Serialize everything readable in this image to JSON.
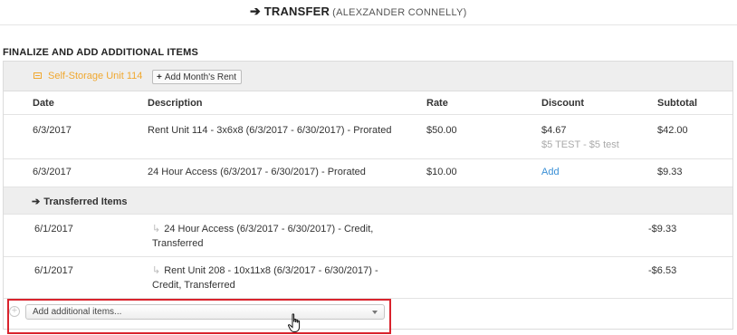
{
  "header": {
    "arrow": "➔",
    "title": "TRANSFER",
    "subtitle": "(ALEXZANDER CONNELLY)"
  },
  "section_title": "FINALIZE AND ADD ADDITIONAL ITEMS",
  "unit": {
    "icon": "storage-unit-icon",
    "name": "Self-Storage Unit 114",
    "add_rent_label": "Add Month's Rent",
    "plus": "+"
  },
  "table": {
    "columns": [
      "Date",
      "Description",
      "Rate",
      "Discount",
      "Subtotal"
    ],
    "rows": [
      {
        "date": "6/3/2017",
        "description": "Rent Unit 114 - 3x6x8 (6/3/2017 - 6/30/2017) - Prorated",
        "rate": "$50.00",
        "discount": "$4.67",
        "discount_note": "$5 TEST - $5 test",
        "subtotal": "$42.00"
      },
      {
        "date": "6/3/2017",
        "description": "24 Hour Access (6/3/2017 - 6/30/2017) - Prorated",
        "rate": "$10.00",
        "discount_link": "Add",
        "subtotal": "$9.33"
      }
    ]
  },
  "transferred": {
    "arrow": "➔",
    "label": "Transferred Items",
    "child_arrow": "↳",
    "rows": [
      {
        "date": "6/1/2017",
        "description": "24 Hour Access (6/3/2017 - 6/30/2017) - Credit, Transferred",
        "subtotal": "-$9.33"
      },
      {
        "date": "6/1/2017",
        "description": "Rent Unit 208 - 10x11x8 (6/3/2017 - 6/30/2017) - Credit, Transferred",
        "subtotal": "-$6.53"
      }
    ]
  },
  "add_items": {
    "plus": "+",
    "placeholder": "Add additional items..."
  },
  "colors": {
    "accent_orange": "#f0a830",
    "link_blue": "#3a8fd6",
    "highlight_red": "#d9232d"
  }
}
